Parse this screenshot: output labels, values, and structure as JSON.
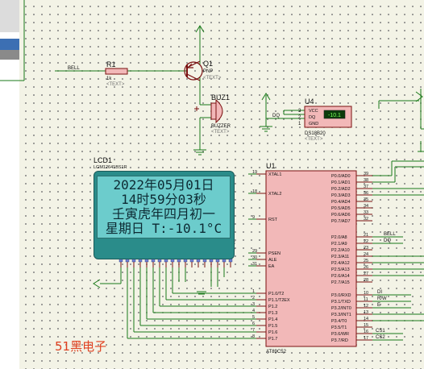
{
  "lcd": {
    "ref": "LCD1",
    "model": "LGM12641BS1R",
    "line1": "2022年05月01日",
    "line2": "14时59分03秒",
    "line3": "壬寅虎年四月初一",
    "line4": "星期日 T:-10.1°C",
    "pins": [
      "CS1",
      "CS2",
      "GND",
      "VCC",
      "V0",
      "RS",
      "R/W",
      "E",
      "DB0",
      "DB1",
      "DB2",
      "DB3",
      "DB4",
      "DB5",
      "DB6",
      "DB7",
      "RST",
      "-Vout"
    ]
  },
  "mcu": {
    "ref": "U1",
    "model": "AT89C52",
    "left_pins": [
      {
        "num": "19",
        "name": "XTAL1"
      },
      {
        "num": "18",
        "name": "XTAL2"
      },
      {
        "num": "9",
        "name": "RST"
      },
      {
        "num": "29",
        "name": "PSEN"
      },
      {
        "num": "30",
        "name": "ALE"
      },
      {
        "num": "31",
        "name": "EA"
      },
      {
        "num": "1",
        "name": "P1.0/T2"
      },
      {
        "num": "2",
        "name": "P1.1/T2EX"
      },
      {
        "num": "3",
        "name": "P1.2"
      },
      {
        "num": "4",
        "name": "P1.3"
      },
      {
        "num": "5",
        "name": "P1.4"
      },
      {
        "num": "6",
        "name": "P1.5"
      },
      {
        "num": "7",
        "name": "P1.6"
      },
      {
        "num": "8",
        "name": "P1.7"
      }
    ],
    "right_pins": [
      {
        "num": "39",
        "name": "P0.0/AD0"
      },
      {
        "num": "38",
        "name": "P0.1/AD1"
      },
      {
        "num": "37",
        "name": "P0.2/AD2"
      },
      {
        "num": "36",
        "name": "P0.3/AD3"
      },
      {
        "num": "35",
        "name": "P0.4/AD4"
      },
      {
        "num": "34",
        "name": "P0.5/AD5"
      },
      {
        "num": "33",
        "name": "P0.6/AD6"
      },
      {
        "num": "32",
        "name": "P0.7/AD7"
      },
      {
        "num": "21",
        "name": "P2.0/A8"
      },
      {
        "num": "22",
        "name": "P2.1/A9"
      },
      {
        "num": "23",
        "name": "P2.2/A10"
      },
      {
        "num": "24",
        "name": "P2.3/A11"
      },
      {
        "num": "25",
        "name": "P2.4/A12"
      },
      {
        "num": "26",
        "name": "P2.5/A13"
      },
      {
        "num": "27",
        "name": "P2.6/A14"
      },
      {
        "num": "28",
        "name": "P2.7/A15"
      },
      {
        "num": "10",
        "name": "P3.0/RXD"
      },
      {
        "num": "11",
        "name": "P3.1/TXD"
      },
      {
        "num": "12",
        "name": "P3.2/INT0"
      },
      {
        "num": "13",
        "name": "P3.3/INT1"
      },
      {
        "num": "14",
        "name": "P3.4/T0"
      },
      {
        "num": "15",
        "name": "P3.5/T1"
      },
      {
        "num": "16",
        "name": "P3.6/WR"
      },
      {
        "num": "17",
        "name": "P3.7/RD"
      }
    ],
    "net_labels": {
      "p2_0": "BELL",
      "p2_1": "DQ",
      "p3_0": "DI",
      "p3_1": "R/W",
      "p3_2": "E",
      "p3_5": "CS1",
      "p3_6": "CS2"
    }
  },
  "transistor": {
    "ref": "Q1",
    "type": "PNP",
    "text": "<TEXT>"
  },
  "resistor": {
    "ref": "R1",
    "value": "1k",
    "text": "<TEXT>"
  },
  "buzzer": {
    "ref": "BUZ1",
    "type": "BUZZER",
    "text": "<TEXT>"
  },
  "sensor": {
    "ref": "U4",
    "model": "DS18B20",
    "text": "<TEXT>",
    "reading": "-10.1",
    "pins": {
      "vcc": "VCC",
      "dq": "DQ",
      "gnd": "GND"
    },
    "pin_nums": {
      "vcc": "3",
      "dq": "2",
      "gnd": "1"
    }
  },
  "nets": {
    "bell": "BELL",
    "dq": "DQ"
  },
  "watermark": "51黑电子",
  "colors": {
    "wire": "#1a7a1a",
    "body": "#f2b8b8",
    "body_outline": "#7a1010",
    "pin": "#b00000",
    "pin_num": "#1a1a1a",
    "lcd_bezel": "#2a8c8a",
    "lcd_screen": "#6ccccc",
    "sheet": "#f3f3e6",
    "watermark": "#e04020"
  }
}
